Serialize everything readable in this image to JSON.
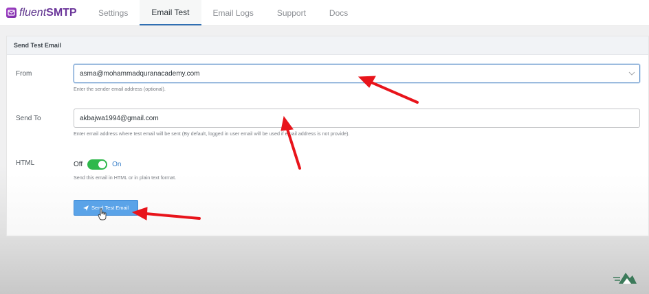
{
  "brand": {
    "name_part1": "fluent",
    "name_part2": "SMTP"
  },
  "nav": {
    "tabs": [
      {
        "label": "Settings"
      },
      {
        "label": "Email Test"
      },
      {
        "label": "Email Logs"
      },
      {
        "label": "Support"
      },
      {
        "label": "Docs"
      }
    ],
    "active": "Email Test"
  },
  "card": {
    "title": "Send Test Email"
  },
  "form": {
    "from": {
      "label": "From",
      "value": "asma@mohammadquranacademy.com",
      "help": "Enter the sender email address (optional)."
    },
    "send_to": {
      "label": "Send To",
      "value": "akbajwa1994@gmail.com",
      "help": "Enter email address where test email will be sent (By default, logged in user email will be used if email address is not provide)."
    },
    "html": {
      "label": "HTML",
      "off_label": "Off",
      "on_label": "On",
      "help": "Send this email in HTML or in plain text format."
    },
    "submit_label": "Send Test Email"
  },
  "colors": {
    "accent": "#2f6fb3",
    "button": "#5aa3e8",
    "toggle_on": "#2eb84b",
    "annotation_arrow": "#e8141b"
  },
  "icons": {
    "brand": "fluent-smtp-logo-icon",
    "dropdown": "chevron-down-icon",
    "send": "paper-plane-icon",
    "cursor": "hand-cursor-icon",
    "watermark": "channel-logo-icon"
  }
}
